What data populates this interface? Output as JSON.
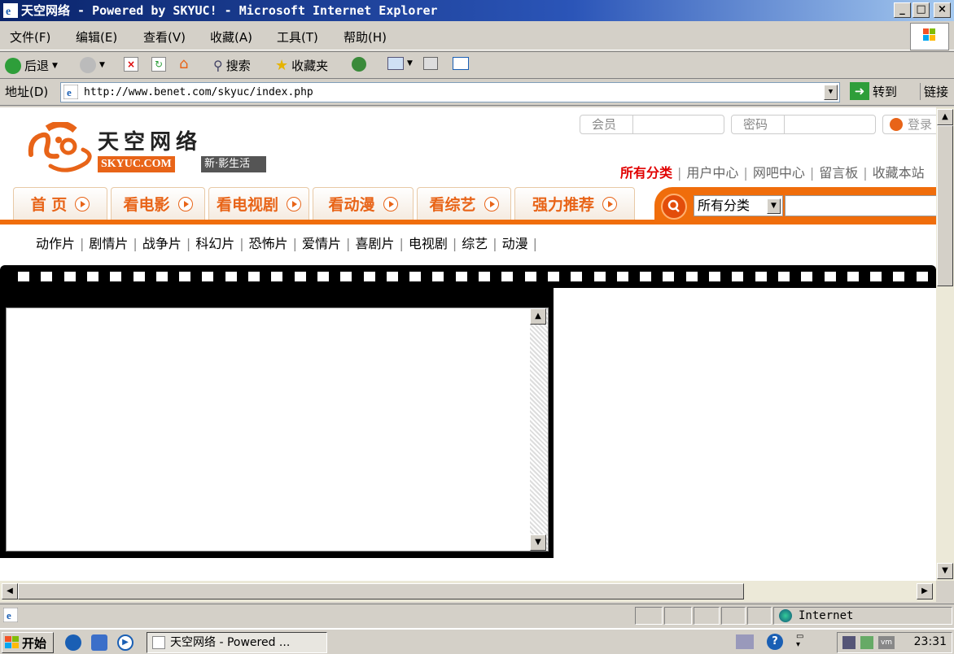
{
  "window": {
    "title": "天空网络 - Powered by SKYUC! - Microsoft Internet Explorer"
  },
  "menu": [
    "文件(F)",
    "编辑(E)",
    "查看(V)",
    "收藏(A)",
    "工具(T)",
    "帮助(H)"
  ],
  "toolbar": {
    "back": "后退",
    "search": "搜索",
    "favorites": "收藏夹"
  },
  "address": {
    "label": "地址(D)",
    "url": "http://www.benet.com/skyuc/index.php",
    "go": "转到",
    "links": "链接"
  },
  "site": {
    "logo_cn": "天空网络",
    "logo_en": "SKYUC.COM",
    "logo_tag": "新·影生活",
    "login": {
      "member_label": "会员",
      "password_label": "密码",
      "login_button": "登录"
    },
    "top_links": [
      "所有分类",
      "用户中心",
      "网吧中心",
      "留言板",
      "收藏本站"
    ],
    "nav_tabs": [
      "首 页",
      "看电影",
      "看电视剧",
      "看动漫",
      "看综艺",
      "强力推荐"
    ],
    "search_category": "所有分类",
    "subnav": [
      "动作片",
      "剧情片",
      "战争片",
      "科幻片",
      "恐怖片",
      "爱情片",
      "喜剧片",
      "电视剧",
      "综艺",
      "动漫"
    ]
  },
  "status": {
    "zone": "Internet"
  },
  "taskbar": {
    "start": "开始",
    "task": "天空网络 - Powered ...",
    "clock": "23:31"
  },
  "colors": {
    "accent": "#f06d0b",
    "title_bar": "#0a246a",
    "top_link_active": "#e10000"
  }
}
